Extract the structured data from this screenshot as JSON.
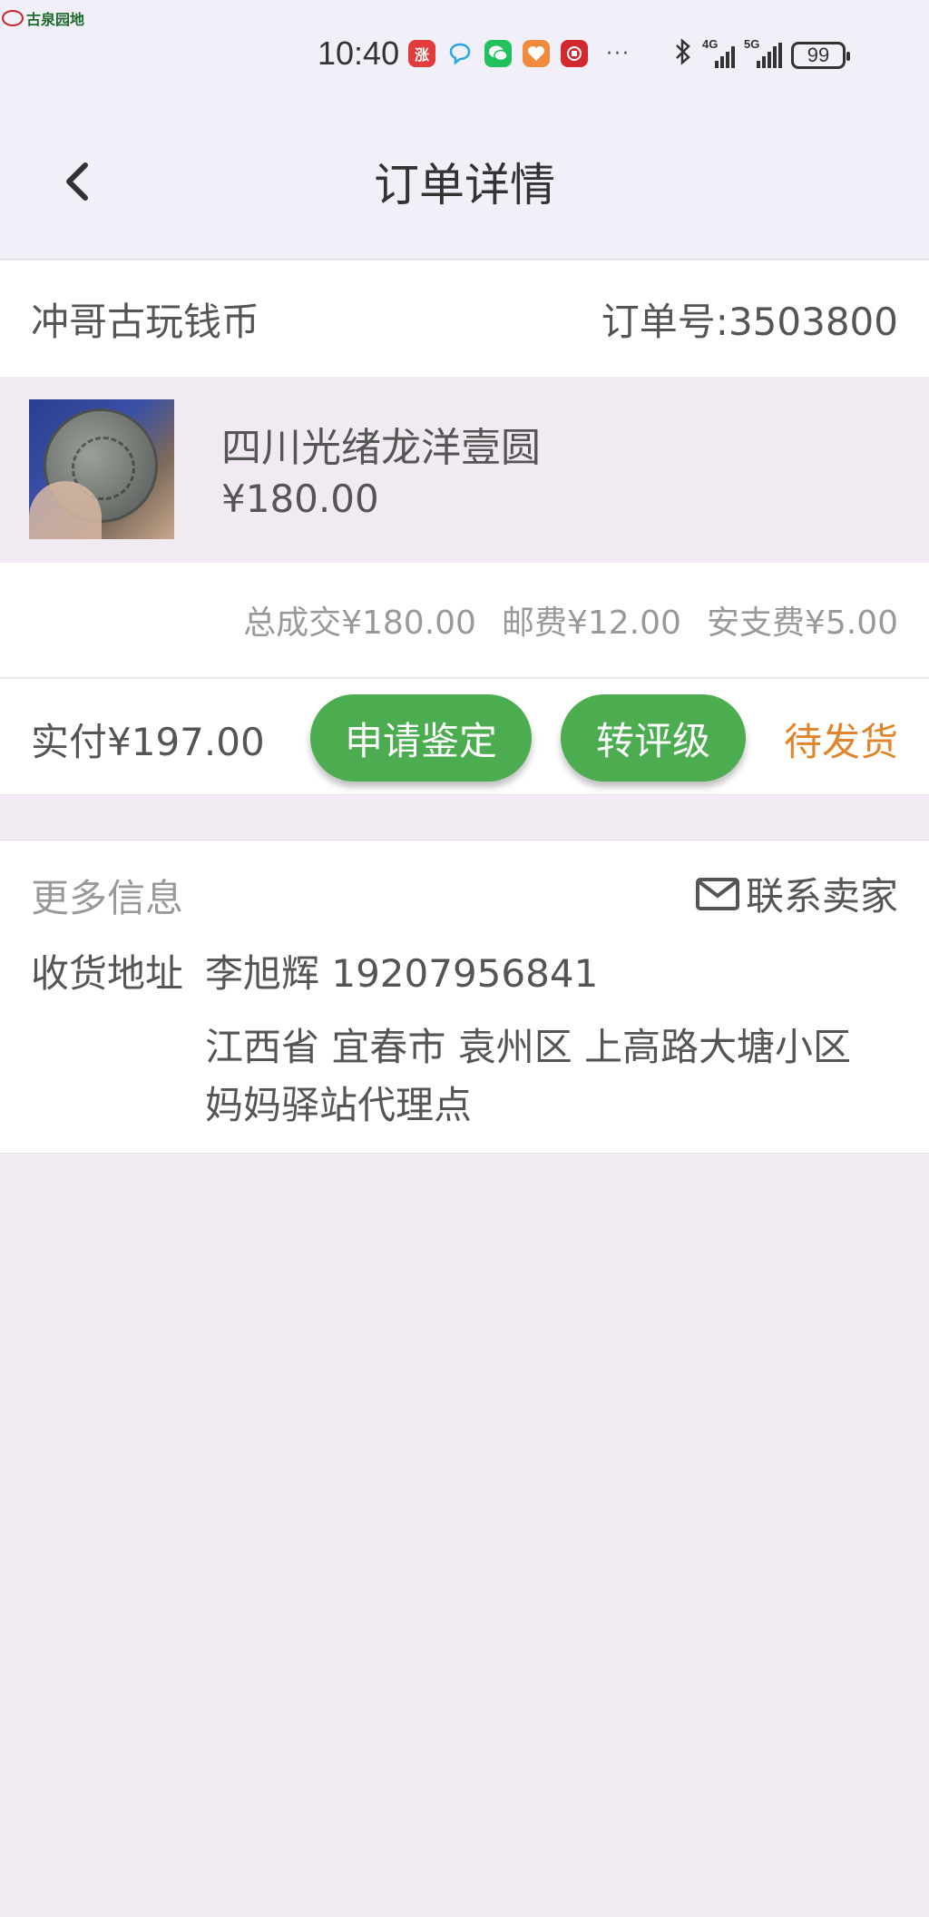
{
  "status_bar": {
    "watermark": "古泉园地",
    "time": "10:40",
    "more": "···",
    "signal_1": "4G",
    "signal_2": "5G",
    "battery": "99",
    "app_icons": [
      "zhang-app-icon",
      "chat-bubble-icon",
      "wechat-icon",
      "health-app-icon",
      "bank-app-icon"
    ]
  },
  "header": {
    "title": "订单详情"
  },
  "shop": {
    "name": "冲哥古玩钱币",
    "order_number": "订单号:3503800"
  },
  "product": {
    "name": "四川光绪龙洋壹圆",
    "price": "¥180.00"
  },
  "fees": {
    "total": "总成交¥180.00",
    "shipping": "邮费¥12.00",
    "service": "安支费¥5.00"
  },
  "payment": {
    "paid": "实付¥197.00",
    "appraise_label": "申请鉴定",
    "grade_label": "转评级",
    "status": "待发货"
  },
  "info": {
    "title": "更多信息",
    "contact_label": "联系卖家",
    "address_label": "收货地址",
    "recipient": "李旭辉 19207956841",
    "address": "江西省 宜春市 袁州区 上高路大塘小区妈妈驿站代理点"
  },
  "colors": {
    "accent_green": "#4cad50",
    "status_orange": "#e2852a",
    "page_bg": "#f3ecf5"
  }
}
